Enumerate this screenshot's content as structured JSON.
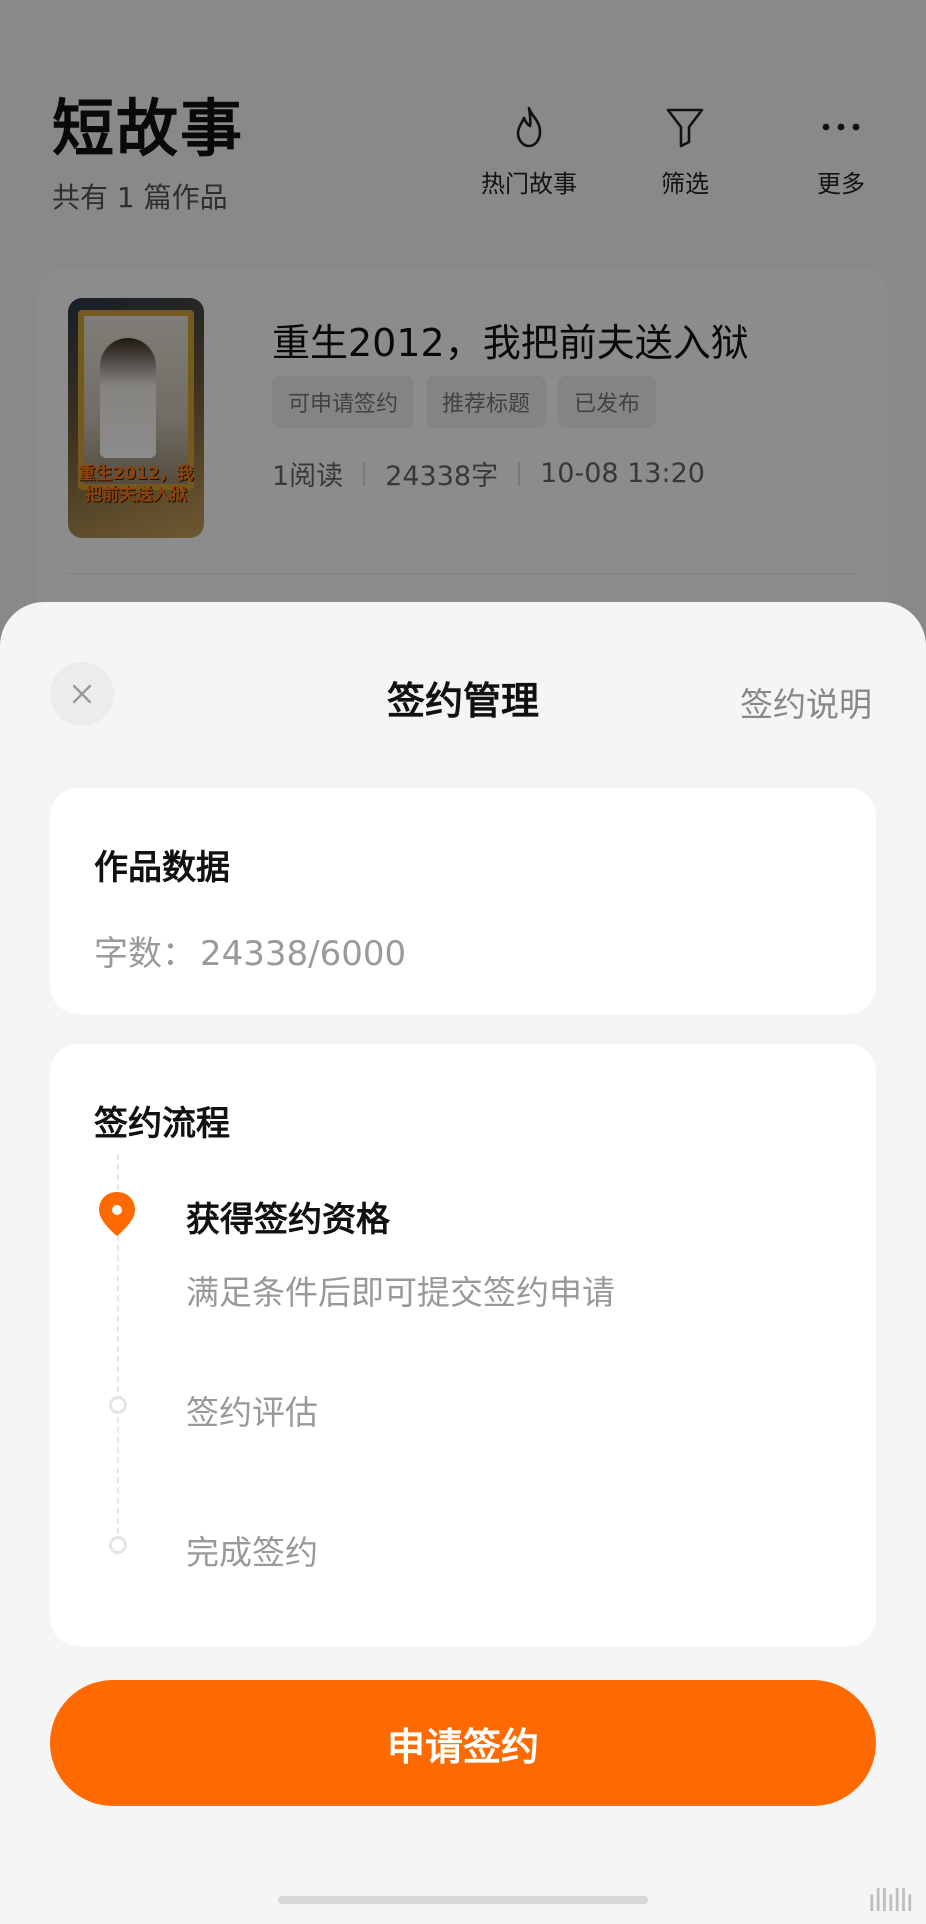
{
  "page": {
    "title": "短故事",
    "subtitle": "共有 1 篇作品",
    "actions": [
      {
        "icon": "flame-icon",
        "label": "热门故事"
      },
      {
        "icon": "filter-icon",
        "label": "筛选"
      },
      {
        "icon": "more-icon",
        "label": "更多"
      }
    ]
  },
  "story": {
    "title": "重生2012，我把前夫送入狱",
    "cover_text": "重生2012，我把前夫送入狱",
    "tags": [
      "可申请签约",
      "推荐标题",
      "已发布"
    ],
    "reads": "1阅读",
    "words": "24338字",
    "time": "10-08 13:20"
  },
  "sheet": {
    "title": "签约管理",
    "help_label": "签约说明",
    "data_panel": {
      "heading": "作品数据",
      "word_label": "字数：",
      "word_value": "24338/6000"
    },
    "flow_panel": {
      "heading": "签约流程",
      "steps": [
        {
          "title": "获得签约资格",
          "desc": "满足条件后即可提交签约申请",
          "active": true
        },
        {
          "title": "签约评估",
          "active": false
        },
        {
          "title": "完成签约",
          "active": false
        }
      ]
    },
    "apply_label": "申请签约"
  },
  "watermark": "ıllıllı",
  "colors": {
    "accent": "#ff6a00",
    "scrim": "rgba(0,0,0,0.45)",
    "sheet_bg": "#f5f5f5"
  }
}
